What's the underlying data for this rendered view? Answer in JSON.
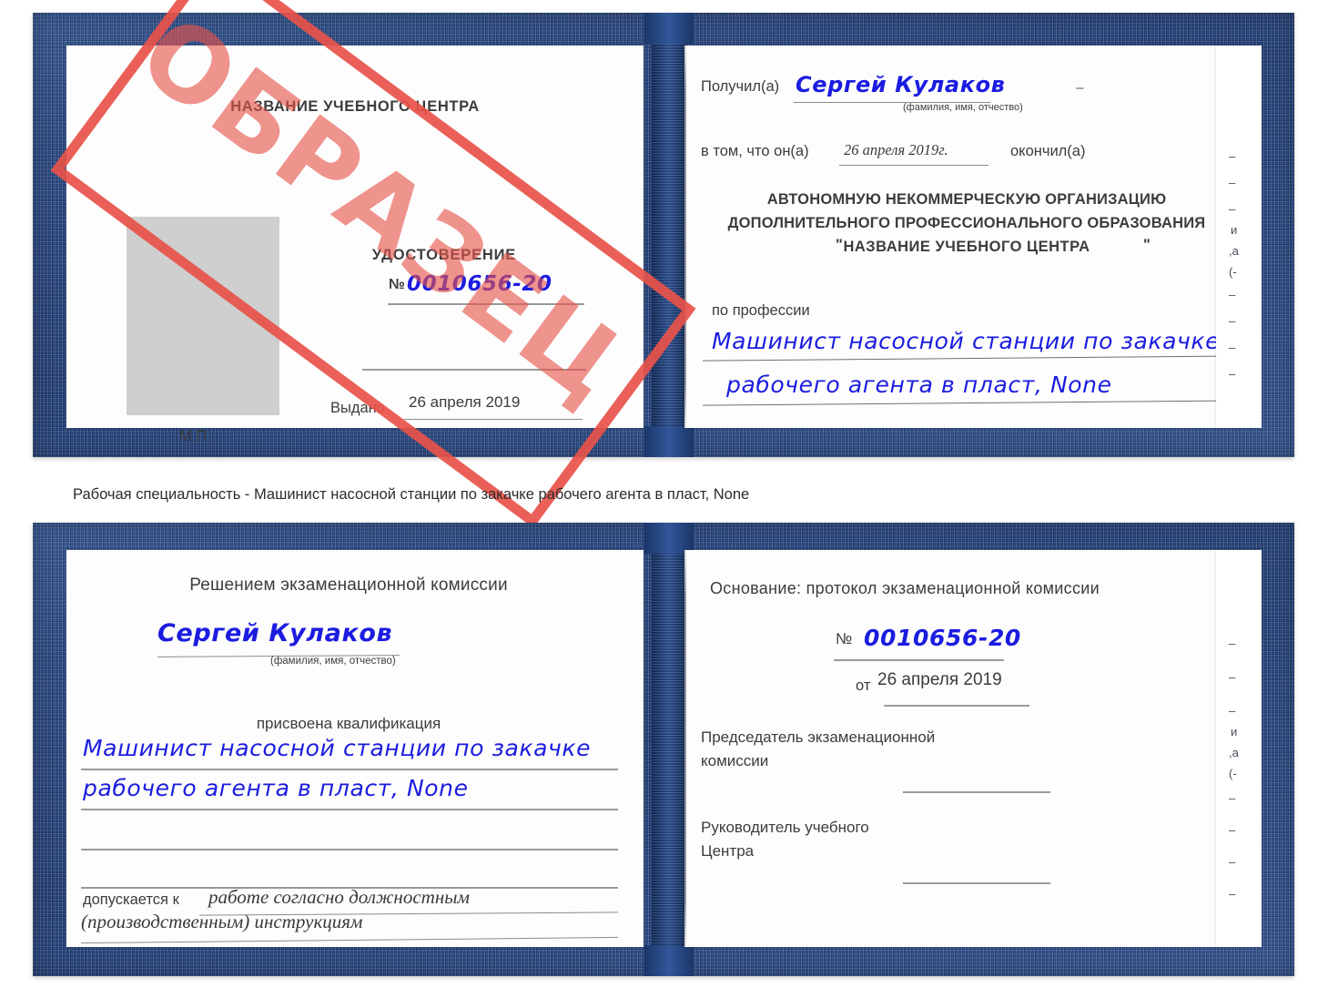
{
  "document": {
    "kind": "Удостоверение (свидетельство) о профессиональной подготовке — образец",
    "stamp_label": "ОБРАЗЕЦ",
    "accent_red": "#e8534a",
    "ink_blue": "#1b1ce0",
    "cover_blue": "#1d3a74"
  },
  "caption": {
    "text": "Рабочая специальность - Машинист насосной станции по закачке рабочего агента в пласт, None"
  },
  "cert_top": {
    "left_page": {
      "org_title": "НАЗВАНИЕ УЧЕБНОГО ЦЕНТРА",
      "doc_title": "УДОСТОВЕРЕНИЕ",
      "number_label": "№",
      "number_value": "0010656-20",
      "issued_label": "Выдано",
      "issued_value": "26 апреля 2019",
      "seal_label": "М.П.",
      "photo_placeholder": "photo-placeholder"
    },
    "right_page": {
      "received_label": "Получил(а)",
      "received_value": "Сергей Кулаков",
      "fio_hint": "(фамилия, имя, отчество)",
      "that_he_label": "в том, что он(а)",
      "completion_date": "26 апреля 2019г.",
      "finished_label": "окончил(а)",
      "org_line1": "АВТОНОМНУЮ НЕКОММЕРЧЕСКУЮ ОРГАНИЗАЦИЮ",
      "org_line2": "ДОПОЛНИТЕЛЬНОГО ПРОФЕССИОНАЛЬНОГО ОБРАЗОВАНИЯ",
      "org_quote_open": "\"",
      "org_line3": "НАЗВАНИЕ УЧЕБНОГО ЦЕНТРА",
      "org_quote_close": "\"",
      "profession_label": "по профессии",
      "profession_line1": "Машинист насосной станции по закачке",
      "profession_line2": "рабочего агента в пласт, None",
      "dash_mark": "–",
      "edge_glyphs": [
        "–",
        "–",
        "–",
        "и",
        ",а",
        "(-",
        "–",
        "–",
        "–",
        "–"
      ]
    }
  },
  "cert_bottom": {
    "left_page": {
      "heading": "Решением экзаменационной комиссии",
      "name_value": "Сергей Кулаков",
      "fio_hint": "(фамилия, имя, отчество)",
      "qualification_label": "присвоена квалификация",
      "qualification_line1": "Машинист насосной станции по закачке",
      "qualification_line2": "рабочего агента в пласт, None",
      "admitted_label": "допускается к",
      "admitted_line1": "работе согласно должностным",
      "admitted_line2": "(производственным) инструкциям"
    },
    "right_page": {
      "basis_label": "Основание: протокол экзаменационной комиссии",
      "number_label": "№",
      "number_value": "0010656-20",
      "date_label": "от",
      "date_value": "26 апреля 2019",
      "chairman_line1": "Председатель экзаменационной",
      "chairman_line2": "комиссии",
      "head_line1": "Руководитель учебного",
      "head_line2": "Центра",
      "edge_glyphs": [
        "–",
        "–",
        "–",
        "и",
        ",а",
        "(-",
        "–",
        "–",
        "–",
        "–"
      ]
    }
  }
}
